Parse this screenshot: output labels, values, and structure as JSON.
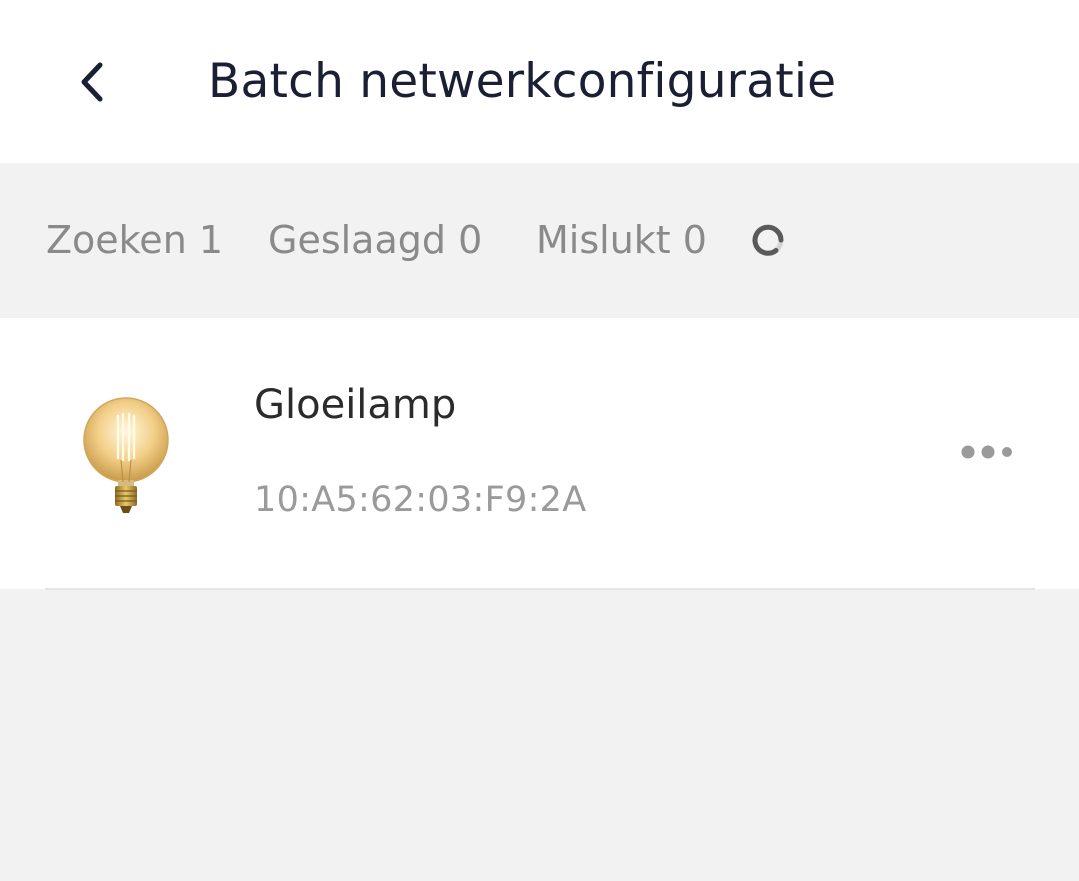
{
  "header": {
    "back_icon": "chevron-left-icon",
    "title": "Batch netwerkconfiguratie"
  },
  "status": {
    "searching": "Zoeken 1",
    "succeeded": "Geslaagd 0",
    "failed": "Mislukt 0",
    "loading_icon": "spinner-icon"
  },
  "devices": [
    {
      "name": "Gloeilamp",
      "mac": "10:A5:62:03:F9:2A",
      "icon": "light-bulb-icon",
      "more_icon": "more-dots-icon"
    }
  ],
  "colors": {
    "title": "#1b1f33",
    "status_text": "#8a8a8a",
    "background": "#f2f2f2",
    "card": "#ffffff"
  }
}
